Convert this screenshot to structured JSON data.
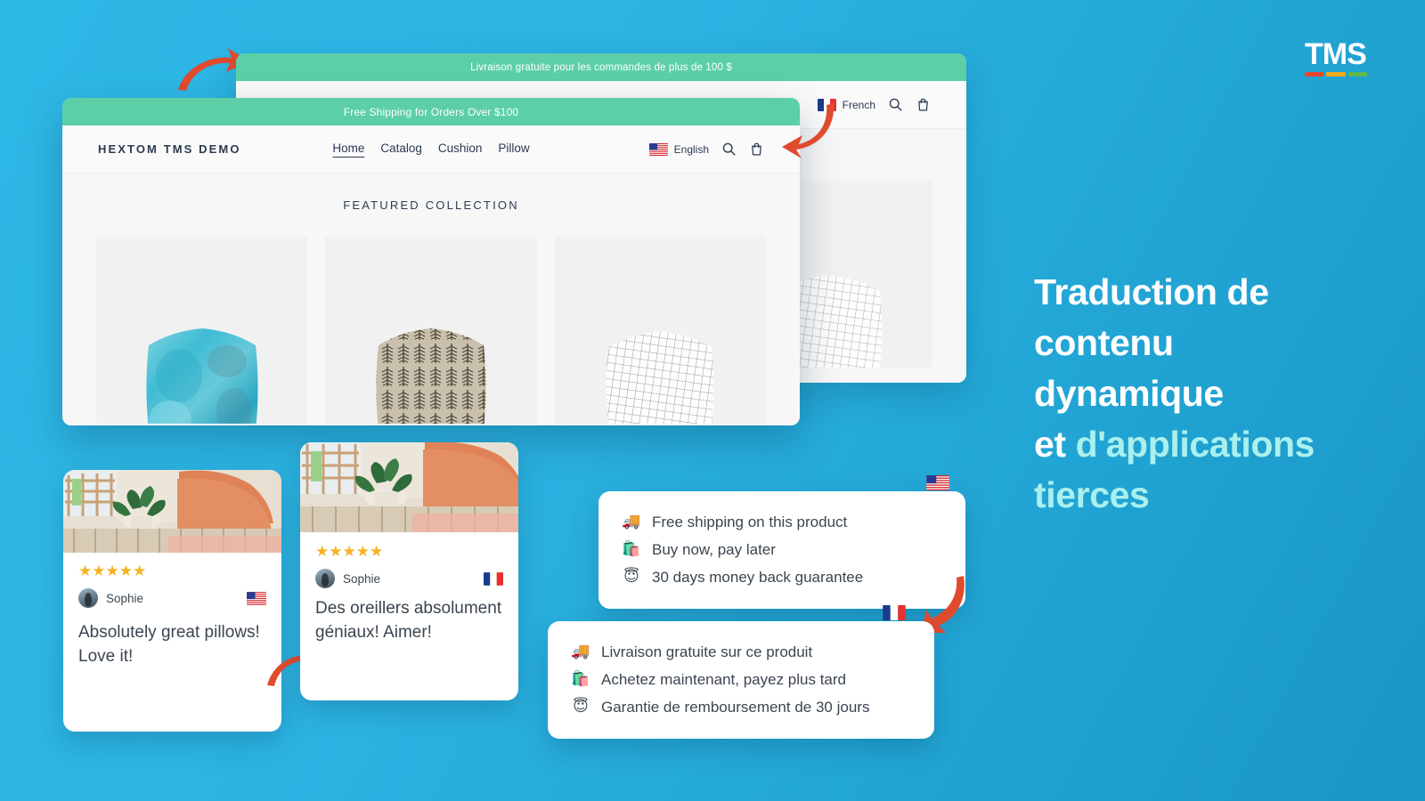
{
  "brand": {
    "logo_text": "TMS",
    "logo_bar_colors": [
      "#e8452c",
      "#f2a81d",
      "#5fb84f"
    ]
  },
  "headline": {
    "line1": "Traduction de",
    "line2": "contenu",
    "line3": "dynamique",
    "line4_plain": "et ",
    "line4_accent": "d'applications",
    "line5_accent": "tierces",
    "color_plain": "#ffffff",
    "color_accent": "#aaf0ee"
  },
  "background": {
    "color_top_left": "#2eb8e6",
    "color_bottom_right": "#1996c6"
  },
  "storefront_french": {
    "promo_banner": "Livraison gratuite pour les commandes de plus de 100 $",
    "promo_color": "#5ccfa6",
    "language": "French",
    "language_flag": "fr-flag-icon",
    "icons": [
      "search-icon",
      "cart-icon"
    ]
  },
  "storefront_english": {
    "promo_banner": "Free Shipping for Orders Over $100",
    "promo_color": "#5ccfa6",
    "store_name": "HEXTOM TMS DEMO",
    "nav": [
      "Home",
      "Catalog",
      "Cushion",
      "Pillow"
    ],
    "nav_active": "Home",
    "language": "English",
    "language_flag": "us-flag-icon",
    "icons": [
      "search-icon",
      "cart-icon"
    ],
    "collection_title": "FEATURED COLLECTION",
    "products": [
      {
        "name": "watercolor-teal-pillow"
      },
      {
        "name": "fern-print-pillow"
      },
      {
        "name": "grid-line-pillow"
      }
    ]
  },
  "reviews": [
    {
      "lang": "en",
      "rating": 5,
      "stars": "★★★★★",
      "reviewer": "Sophie",
      "flag": "us-flag-icon",
      "text": "Absolutely great pillows! Love it!"
    },
    {
      "lang": "fr",
      "rating": 5,
      "stars": "★★★★★",
      "reviewer": "Sophie",
      "flag": "fr-flag-icon",
      "text": "Des oreillers absolument géniaux! Aimer!"
    }
  ],
  "benefits_english": {
    "flag": "us-flag-icon",
    "items": [
      {
        "emoji": "🚚",
        "emoji_name": "delivery-truck-icon",
        "label": "Free shipping on this product"
      },
      {
        "emoji": "🛍️",
        "emoji_name": "shopping-bags-icon",
        "label": "Buy now, pay later"
      },
      {
        "emoji": "😇",
        "emoji_name": "smiling-face-halo-icon",
        "label": "30 days money back guarantee"
      }
    ]
  },
  "benefits_french": {
    "flag": "fr-flag-icon",
    "items": [
      {
        "emoji": "🚚",
        "emoji_name": "delivery-truck-icon",
        "label": "Livraison gratuite sur ce produit"
      },
      {
        "emoji": "🛍️",
        "emoji_name": "shopping-bags-icon",
        "label": "Achetez maintenant, payez plus tard"
      },
      {
        "emoji": "😇",
        "emoji_name": "smiling-face-halo-icon",
        "label": "Garantie de remboursement de 30 jours"
      }
    ]
  },
  "arrows": {
    "color": "#e04b2e",
    "items": [
      {
        "name": "arrow-to-french-storefront"
      },
      {
        "name": "arrow-to-english-cart"
      },
      {
        "name": "arrow-to-french-review"
      },
      {
        "name": "arrow-to-french-benefits"
      }
    ]
  }
}
